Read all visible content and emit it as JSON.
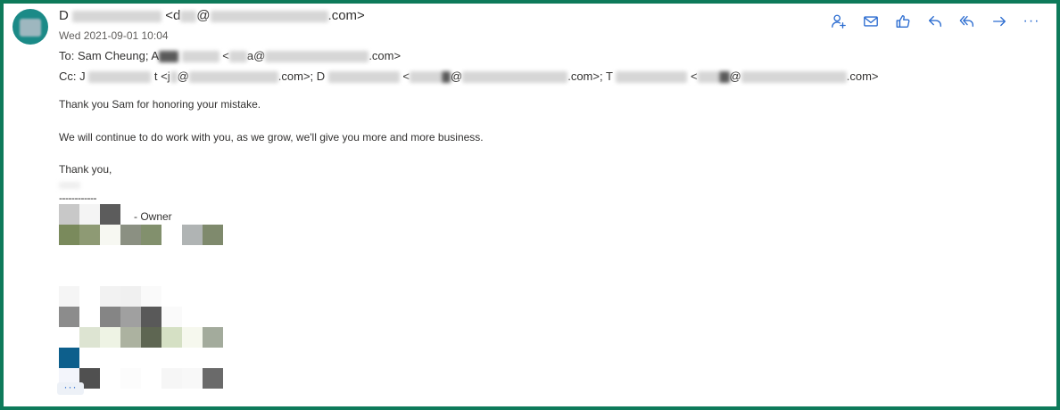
{
  "header": {
    "from_prefix": "D",
    "from_email_open": "<d",
    "from_at": "@",
    "from_domain_end": ".com>",
    "date": "Wed 2021-09-01 10:04",
    "to_prefix": "To:",
    "to_name": "Sam Cheung; A",
    "to_email_open": "<",
    "to_email_mid": "a@",
    "to_email_end": ".com>",
    "cc_prefix": "Cc:",
    "cc_name1": "J",
    "cc_name1b": "t <j",
    "cc_at1": "@",
    "cc_end1": ".com>; D",
    "cc_email2_open": "<",
    "cc_at2": "@",
    "cc_end2": ".com>; T",
    "cc_email3_open": "<",
    "cc_at3": "@",
    "cc_end3": ".com>"
  },
  "toolbar": {
    "items": [
      "person-add-icon",
      "mail-icon",
      "like-icon",
      "reply-icon",
      "reply-all-icon",
      "forward-icon",
      "more-icon"
    ],
    "more_label": "···"
  },
  "message": {
    "line1": "Thank you Sam for honoring your mistake.",
    "line2": "We will continue to do work with you, as we grow, we'll give you more and more business.",
    "line3": "Thank you,",
    "separator": "------------",
    "owner_label": "- Owner"
  },
  "expand": {
    "label": "···"
  },
  "colors": {
    "border": "#0e7a5a",
    "avatar": "#1b8a87",
    "accent": "#2b6cd0"
  },
  "signature_pixels": [
    [
      "#c8c8c8",
      "#f4f4f4",
      "#5c5c5c",
      "#ffffff",
      "#ffffff",
      "#ffffff",
      "#ffffff",
      "#ffffff"
    ],
    [
      "#7a8a5c",
      "#8e9a74",
      "#f7f8f2",
      "#8b9082",
      "#82906d",
      "#ffffff",
      "#b0b4b4",
      "#7f8a6d"
    ],
    [
      "#ffffff",
      "#ffffff",
      "#ffffff",
      "#ffffff",
      "#ffffff",
      "#ffffff",
      "#ffffff",
      "#ffffff"
    ],
    [
      "#f5f5f5",
      "#ffffff",
      "#f2f2f2",
      "#f0f0f0",
      "#fafafa",
      "#ffffff",
      "#ffffff",
      "#ffffff"
    ],
    [
      "#8c8c8c",
      "#ffffff",
      "#858585",
      "#a0a0a0",
      "#595959",
      "#fafafa",
      "#ffffff",
      "#ffffff"
    ],
    [
      "#ffffff",
      "#dde4d2",
      "#eef3e4",
      "#acb2a0",
      "#5e6652",
      "#d5e0c4",
      "#f6f8ee",
      "#a3ab9c"
    ],
    [
      "#0d5f8c",
      "#ffffff",
      "#ffffff",
      "#ffffff",
      "#ffffff",
      "#ffffff",
      "#ffffff",
      "#ffffff"
    ],
    [
      "#f3f5fb",
      "#505050",
      "#ffffff",
      "#fcfcfc",
      "#ffffff",
      "#f6f6f6",
      "#f8f8f8",
      "#6a6a6a"
    ]
  ]
}
